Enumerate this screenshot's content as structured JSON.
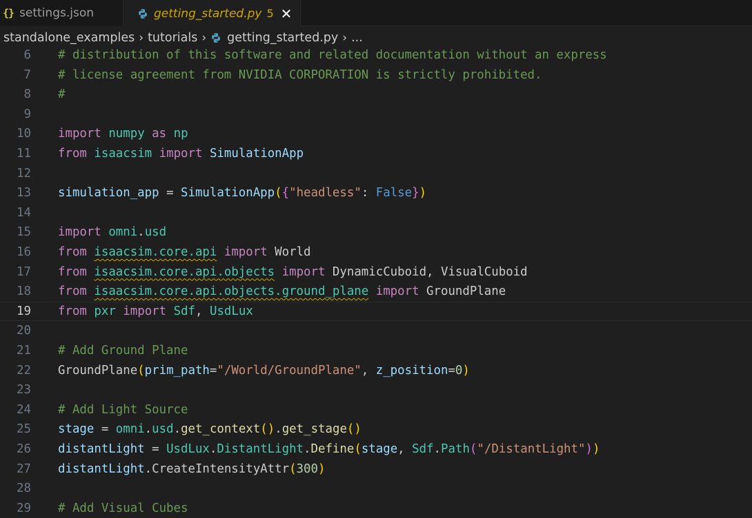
{
  "tabs": [
    {
      "icon": "json-icon",
      "label": "settings.json",
      "active": false
    },
    {
      "icon": "python-icon",
      "label": "getting_started.py",
      "problems": "5",
      "active": true
    }
  ],
  "breadcrumb": [
    "standalone_examples",
    "tutorials",
    "getting_started.py",
    "..."
  ],
  "colors": {
    "background": "#1f1f1f",
    "comment": "#6a9955",
    "keyword": "#c586c0",
    "module": "#4ec9b0",
    "variable": "#9cdcfe",
    "function": "#dcdcaa",
    "string": "#ce9178",
    "constant": "#569cd6",
    "number": "#b5cea8",
    "warning": "#cca700"
  },
  "editor": {
    "current_line": 19,
    "lines": [
      {
        "n": "6",
        "tokens": [
          [
            "comment",
            "# distribution of this software and related documentation without an express"
          ]
        ]
      },
      {
        "n": "7",
        "tokens": [
          [
            "comment",
            "# license agreement from NVIDIA CORPORATION is strictly prohibited."
          ]
        ]
      },
      {
        "n": "8",
        "tokens": [
          [
            "comment",
            "#"
          ]
        ]
      },
      {
        "n": "9",
        "tokens": []
      },
      {
        "n": "10",
        "tokens": [
          [
            "keyword",
            "import"
          ],
          [
            "punct",
            " "
          ],
          [
            "module",
            "numpy"
          ],
          [
            "punct",
            " "
          ],
          [
            "keyword",
            "as"
          ],
          [
            "punct",
            " "
          ],
          [
            "module",
            "np"
          ]
        ]
      },
      {
        "n": "11",
        "tokens": [
          [
            "keyword",
            "from"
          ],
          [
            "punct",
            " "
          ],
          [
            "module",
            "isaacsim"
          ],
          [
            "punct",
            " "
          ],
          [
            "keyword",
            "import"
          ],
          [
            "punct",
            " "
          ],
          [
            "variable",
            "SimulationApp"
          ]
        ]
      },
      {
        "n": "12",
        "tokens": []
      },
      {
        "n": "13",
        "tokens": [
          [
            "variable",
            "simulation_app"
          ],
          [
            "punct",
            " = "
          ],
          [
            "variable",
            "SimulationApp"
          ],
          [
            "brace-1",
            "("
          ],
          [
            "brace-2",
            "{"
          ],
          [
            "string",
            "\"headless\""
          ],
          [
            "punct",
            ": "
          ],
          [
            "const",
            "False"
          ],
          [
            "brace-2",
            "}"
          ],
          [
            "brace-1",
            ")"
          ]
        ]
      },
      {
        "n": "14",
        "tokens": []
      },
      {
        "n": "15",
        "tokens": [
          [
            "keyword",
            "import"
          ],
          [
            "punct",
            " "
          ],
          [
            "module",
            "omni"
          ],
          [
            "punct",
            "."
          ],
          [
            "module",
            "usd"
          ]
        ]
      },
      {
        "n": "16",
        "tokens": [
          [
            "keyword",
            "from"
          ],
          [
            "punct",
            " "
          ],
          [
            "squiggle-module",
            "isaacsim.core.api"
          ],
          [
            "punct",
            " "
          ],
          [
            "keyword",
            "import"
          ],
          [
            "punct",
            " World"
          ]
        ]
      },
      {
        "n": "17",
        "tokens": [
          [
            "keyword",
            "from"
          ],
          [
            "punct",
            " "
          ],
          [
            "squiggle-module",
            "isaacsim.core.api.objects"
          ],
          [
            "punct",
            " "
          ],
          [
            "keyword",
            "import"
          ],
          [
            "punct",
            " DynamicCuboid, VisualCuboid"
          ]
        ]
      },
      {
        "n": "18",
        "tokens": [
          [
            "keyword",
            "from"
          ],
          [
            "punct",
            " "
          ],
          [
            "squiggle-module",
            "isaacsim.core.api.objects.ground_plane"
          ],
          [
            "punct",
            " "
          ],
          [
            "keyword",
            "import"
          ],
          [
            "punct",
            " GroundPlane"
          ]
        ]
      },
      {
        "n": "19",
        "tokens": [
          [
            "keyword",
            "from"
          ],
          [
            "punct",
            " "
          ],
          [
            "module",
            "pxr"
          ],
          [
            "punct",
            " "
          ],
          [
            "keyword",
            "import"
          ],
          [
            "punct",
            " "
          ],
          [
            "class",
            "Sdf"
          ],
          [
            "punct",
            ", "
          ],
          [
            "class",
            "UsdLux"
          ]
        ]
      },
      {
        "n": "20",
        "tokens": []
      },
      {
        "n": "21",
        "tokens": [
          [
            "comment",
            "# Add Ground Plane"
          ]
        ]
      },
      {
        "n": "22",
        "tokens": [
          [
            "punct",
            "GroundPlane"
          ],
          [
            "brace-1",
            "("
          ],
          [
            "variable",
            "prim_path"
          ],
          [
            "punct",
            "="
          ],
          [
            "string",
            "\"/World/GroundPlane\""
          ],
          [
            "punct",
            ", "
          ],
          [
            "variable",
            "z_position"
          ],
          [
            "punct",
            "="
          ],
          [
            "number",
            "0"
          ],
          [
            "brace-1",
            ")"
          ]
        ]
      },
      {
        "n": "23",
        "tokens": []
      },
      {
        "n": "24",
        "tokens": [
          [
            "comment",
            "# Add Light Source"
          ]
        ]
      },
      {
        "n": "25",
        "tokens": [
          [
            "variable",
            "stage"
          ],
          [
            "punct",
            " = "
          ],
          [
            "module",
            "omni"
          ],
          [
            "punct",
            "."
          ],
          [
            "module",
            "usd"
          ],
          [
            "punct",
            "."
          ],
          [
            "function",
            "get_context"
          ],
          [
            "brace-1",
            "("
          ],
          [
            "brace-1",
            ")"
          ],
          [
            "punct",
            "."
          ],
          [
            "function",
            "get_stage"
          ],
          [
            "brace-1",
            "("
          ],
          [
            "brace-1",
            ")"
          ]
        ]
      },
      {
        "n": "26",
        "tokens": [
          [
            "variable",
            "distantLight"
          ],
          [
            "punct",
            " = "
          ],
          [
            "class",
            "UsdLux"
          ],
          [
            "punct",
            "."
          ],
          [
            "class",
            "DistantLight"
          ],
          [
            "punct",
            "."
          ],
          [
            "function",
            "Define"
          ],
          [
            "brace-1",
            "("
          ],
          [
            "variable",
            "stage"
          ],
          [
            "punct",
            ", "
          ],
          [
            "class",
            "Sdf"
          ],
          [
            "punct",
            "."
          ],
          [
            "class",
            "Path"
          ],
          [
            "brace-2",
            "("
          ],
          [
            "string",
            "\"/DistantLight\""
          ],
          [
            "brace-2",
            ")"
          ],
          [
            "brace-1",
            ")"
          ]
        ]
      },
      {
        "n": "27",
        "tokens": [
          [
            "variable",
            "distantLight"
          ],
          [
            "punct",
            "."
          ],
          [
            "punct",
            "CreateIntensityAttr"
          ],
          [
            "brace-1",
            "("
          ],
          [
            "number",
            "300"
          ],
          [
            "brace-1",
            ")"
          ]
        ]
      },
      {
        "n": "28",
        "tokens": []
      },
      {
        "n": "29",
        "tokens": [
          [
            "comment",
            "# Add Visual Cubes"
          ]
        ]
      }
    ]
  }
}
